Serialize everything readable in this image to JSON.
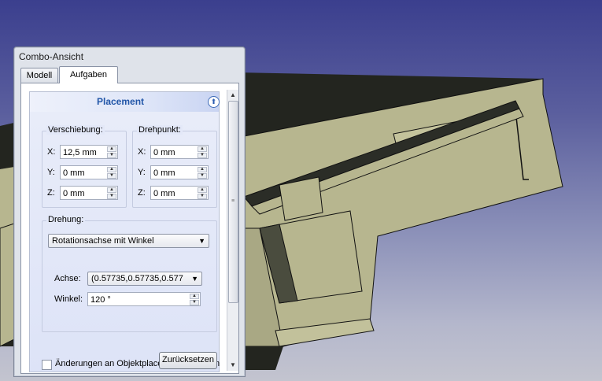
{
  "window": {
    "title": "Combo-Ansicht"
  },
  "tabs": [
    {
      "label": "Modell",
      "active": false
    },
    {
      "label": "Aufgaben",
      "active": true
    }
  ],
  "panel": {
    "title": "Placement",
    "translation": {
      "label": "Verschiebung:",
      "x": {
        "label": "X:",
        "value": "12,5 mm"
      },
      "y": {
        "label": "Y:",
        "value": "0 mm"
      },
      "z": {
        "label": "Z:",
        "value": "0 mm"
      }
    },
    "pivot": {
      "label": "Drehpunkt:",
      "x": {
        "label": "X:",
        "value": "0 mm"
      },
      "y": {
        "label": "Y:",
        "value": "0 mm"
      },
      "z": {
        "label": "Z:",
        "value": "0 mm"
      }
    },
    "rotation": {
      "label": "Drehung:",
      "mode": "Rotationsachse mit Winkel",
      "axis": {
        "label": "Achse:",
        "value": "(0.57735,0.57735,0.577"
      },
      "angle": {
        "label": "Winkel:",
        "value": "120 °"
      }
    },
    "incremental": {
      "label": "Änderungen an Objektplacement inkremen",
      "checked": false
    },
    "reset_button": "Zurücksetzen"
  },
  "colors": {
    "model_face": "#b7b68f",
    "model_dark": "#23251f",
    "accent_title": "#2256a8"
  }
}
